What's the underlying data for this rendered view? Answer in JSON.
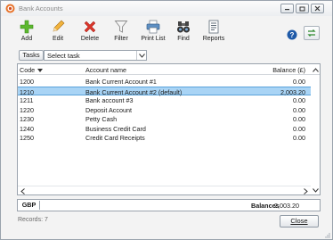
{
  "window": {
    "title": "Bank Accounts",
    "controls": [
      "minimize",
      "maximize",
      "close"
    ]
  },
  "toolbar": {
    "items": [
      {
        "label": "Add",
        "icon": "plus-icon"
      },
      {
        "label": "Edit",
        "icon": "pencil-icon"
      },
      {
        "label": "Delete",
        "icon": "x-icon"
      },
      {
        "label": "Filter",
        "icon": "funnel-icon"
      },
      {
        "label": "Print List",
        "icon": "printer-icon"
      },
      {
        "label": "Find",
        "icon": "binoculars-icon"
      },
      {
        "label": "Reports",
        "icon": "report-icon"
      }
    ],
    "help_icon": "help-icon",
    "refresh_icon": "refresh-icon"
  },
  "tasks": {
    "button_label": "Tasks",
    "select_value": "Select task"
  },
  "grid": {
    "columns": [
      "Code",
      "Account name",
      "Balance (£)"
    ],
    "sort_column": "Code",
    "rows": [
      {
        "code": "1200",
        "name": "Bank Current Account #1",
        "balance": "0.00",
        "selected": false
      },
      {
        "code": "1210",
        "name": "Bank Current Account #2 (default)",
        "balance": "2,003.20",
        "selected": true
      },
      {
        "code": "1211",
        "name": "Bank account #3",
        "balance": "0.00",
        "selected": false
      },
      {
        "code": "1220",
        "name": "Deposit Account",
        "balance": "0.00",
        "selected": false
      },
      {
        "code": "1230",
        "name": "Petty Cash",
        "balance": "0.00",
        "selected": false
      },
      {
        "code": "1240",
        "name": "Business Credit Card",
        "balance": "0.00",
        "selected": false
      },
      {
        "code": "1250",
        "name": "Credit Card Receipts",
        "balance": "0.00",
        "selected": false
      }
    ]
  },
  "footer": {
    "currency": "GBP",
    "balances_label": "Balances",
    "balances_value": "2,003.20"
  },
  "status": {
    "records": "Records: 7"
  },
  "close_label": "Close"
}
